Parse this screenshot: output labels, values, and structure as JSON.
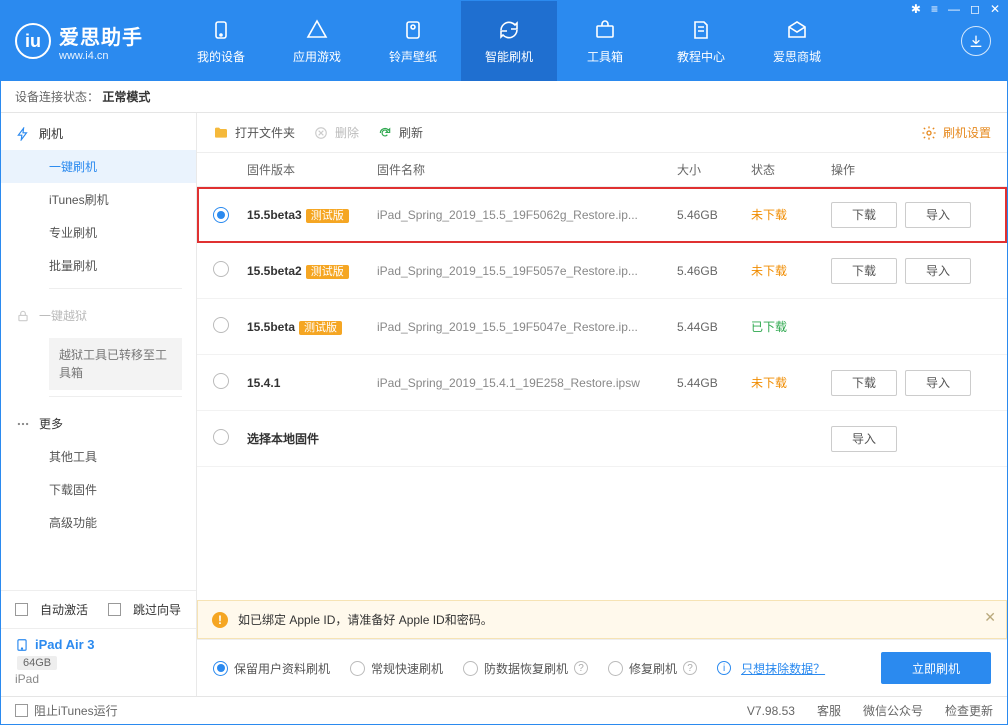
{
  "window_controls": {
    "settings": "✱",
    "menu": "≡",
    "min": "—",
    "max": "◻",
    "close": "✕"
  },
  "brand": {
    "badge": "iu",
    "title": "爱思助手",
    "subtitle": "www.i4.cn"
  },
  "nav": [
    {
      "label": "我的设备"
    },
    {
      "label": "应用游戏"
    },
    {
      "label": "铃声壁纸"
    },
    {
      "label": "智能刷机",
      "active": true
    },
    {
      "label": "工具箱"
    },
    {
      "label": "教程中心"
    },
    {
      "label": "爱思商城"
    }
  ],
  "subbar": {
    "label": "设备连接状态：",
    "value": "正常模式"
  },
  "sidebar": {
    "flash_group": "刷机",
    "flash_items": [
      "一键刷机",
      "iTunes刷机",
      "专业刷机",
      "批量刷机"
    ],
    "jailbreak_group": "一键越狱",
    "jailbreak_note": "越狱工具已转移至工具箱",
    "more_group": "更多",
    "more_items": [
      "其他工具",
      "下载固件",
      "高级功能"
    ],
    "auto_activate": "自动激活",
    "skip_guide": "跳过向导",
    "device_name": "iPad Air 3",
    "storage": "64GB",
    "device_type": "iPad"
  },
  "toolbar": {
    "open": "打开文件夹",
    "delete": "删除",
    "refresh": "刷新",
    "settings": "刷机设置"
  },
  "columns": {
    "version": "固件版本",
    "name": "固件名称",
    "size": "大小",
    "status": "状态",
    "ops": "操作"
  },
  "rows": [
    {
      "selected": true,
      "highlight": true,
      "version": "15.5beta3",
      "tag": "测试版",
      "name": "iPad_Spring_2019_15.5_19F5062g_Restore.ip...",
      "size": "5.46GB",
      "status": "未下载",
      "status_kind": "not",
      "download": true,
      "import": true
    },
    {
      "selected": false,
      "version": "15.5beta2",
      "tag": "测试版",
      "name": "iPad_Spring_2019_15.5_19F5057e_Restore.ip...",
      "size": "5.46GB",
      "status": "未下载",
      "status_kind": "not",
      "download": true,
      "import": true
    },
    {
      "selected": false,
      "version": "15.5beta",
      "tag": "测试版",
      "name": "iPad_Spring_2019_15.5_19F5047e_Restore.ip...",
      "size": "5.44GB",
      "status": "已下载",
      "status_kind": "done",
      "download": false,
      "import": false
    },
    {
      "selected": false,
      "version": "15.4.1",
      "tag": "",
      "name": "iPad_Spring_2019_15.4.1_19E258_Restore.ipsw",
      "size": "5.44GB",
      "status": "未下载",
      "status_kind": "not",
      "download": true,
      "import": true
    },
    {
      "selected": false,
      "version": "选择本地固件",
      "tag": "",
      "name": "",
      "size": "",
      "status": "",
      "status_kind": "",
      "download": false,
      "import": true
    }
  ],
  "btns": {
    "download": "下载",
    "import": "导入"
  },
  "notice": "如已绑定 Apple ID，请准备好 Apple ID和密码。",
  "modes": {
    "keep": "保留用户资料刷机",
    "normal": "常规快速刷机",
    "anti": "防数据恢复刷机",
    "repair": "修复刷机",
    "erase_label": "只想抹除数据？",
    "flash_now": "立即刷机"
  },
  "statusbar": {
    "block_itunes": "阻止iTunes运行",
    "version": "V7.98.53",
    "support": "客服",
    "wechat": "微信公众号",
    "update": "检查更新"
  }
}
